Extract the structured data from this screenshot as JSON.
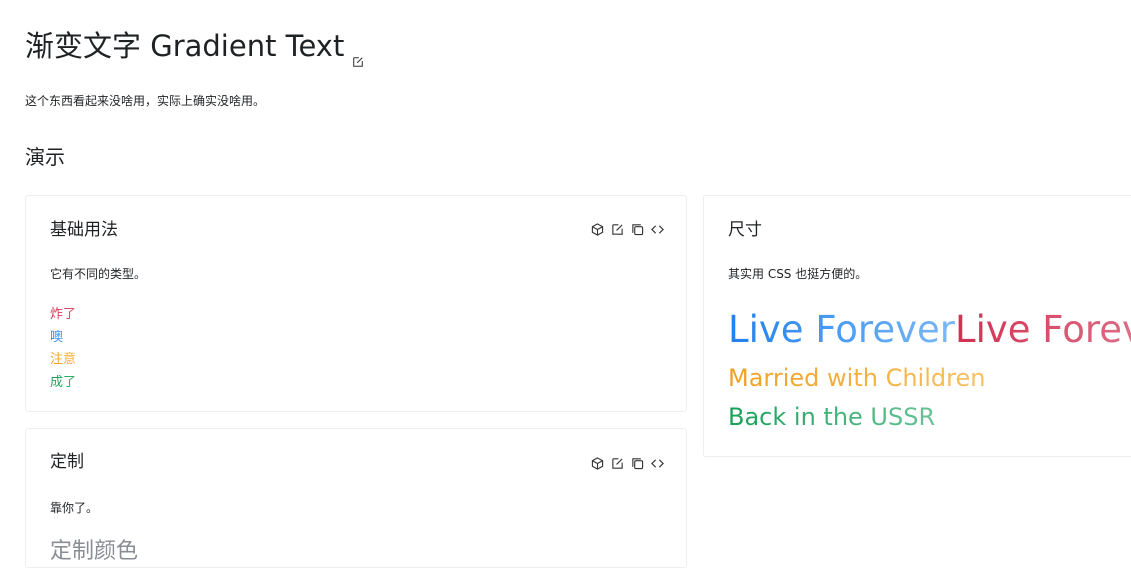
{
  "page": {
    "title": "渐变文字 Gradient Text",
    "intro": "这个东西看起来没啥用，实际上确实没啥用。",
    "demo_heading": "演示"
  },
  "cards": {
    "basic": {
      "title": "基础用法",
      "desc": "它有不同的类型。",
      "items": [
        "炸了",
        "噢",
        "注意",
        "成了"
      ]
    },
    "size": {
      "title": "尺寸",
      "desc": "其实用 CSS 也挺方便的。",
      "line1_a": "Live Forever",
      "line1_b": "Live Foreve",
      "line2": "Married with Children",
      "line3": "Back in the USSR"
    },
    "custom": {
      "title": "定制",
      "desc": "靠你了。",
      "sample": "定制颜色"
    }
  },
  "icons": {
    "toolbar": [
      "cube-icon",
      "edit-icon",
      "copy-icon",
      "code-icon"
    ],
    "title_edit": "edit-icon"
  },
  "colors": {
    "info": "#2080f0",
    "danger": "#d03050",
    "warning": "#f0a020",
    "success": "#18a058"
  }
}
